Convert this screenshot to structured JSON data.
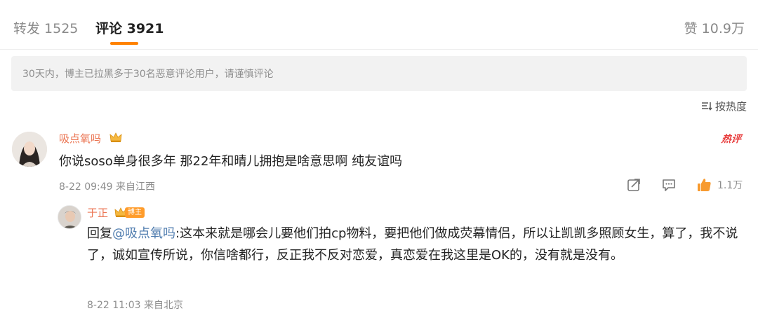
{
  "tabs": {
    "repost": "转发 1525",
    "comment": "评论 3921",
    "like": "赞 10.9万"
  },
  "notice": "30天内，博主已拉黑多于30名恶意评论用户，请谨慎评论",
  "sort_label": "按热度",
  "comment": {
    "username": "吸点氧吗",
    "hot_badge": "热评",
    "text": "你说soso单身很多年 那22年和晴儿拥抱是啥意思啊 纯友谊吗",
    "meta": "8-22 09:49  来自江西",
    "like_count": "1.1万"
  },
  "reply": {
    "username": "于正",
    "poster_badge": "博主",
    "prefix": "回复",
    "mention": "@吸点氧吗",
    "text": ":这本来就是哪会儿要他们拍cp物料，要把他们做成荧幕情侣，所以让凯凯多照顾女生，算了，我不说了，诚如宣传所说，你信啥都行，反正我不反对恋爱，真恋爱在我这里是OK的，没有就是没有。",
    "meta": "8-22 11:03  来自北京"
  },
  "colors": {
    "accent": "#ff8200",
    "username": "#eb7350",
    "mention": "#507daf",
    "hot": "#e83d3d"
  },
  "icons": [
    "sort-icon",
    "crown-icon",
    "share-icon",
    "comment-icon",
    "thumbs-up-icon"
  ]
}
